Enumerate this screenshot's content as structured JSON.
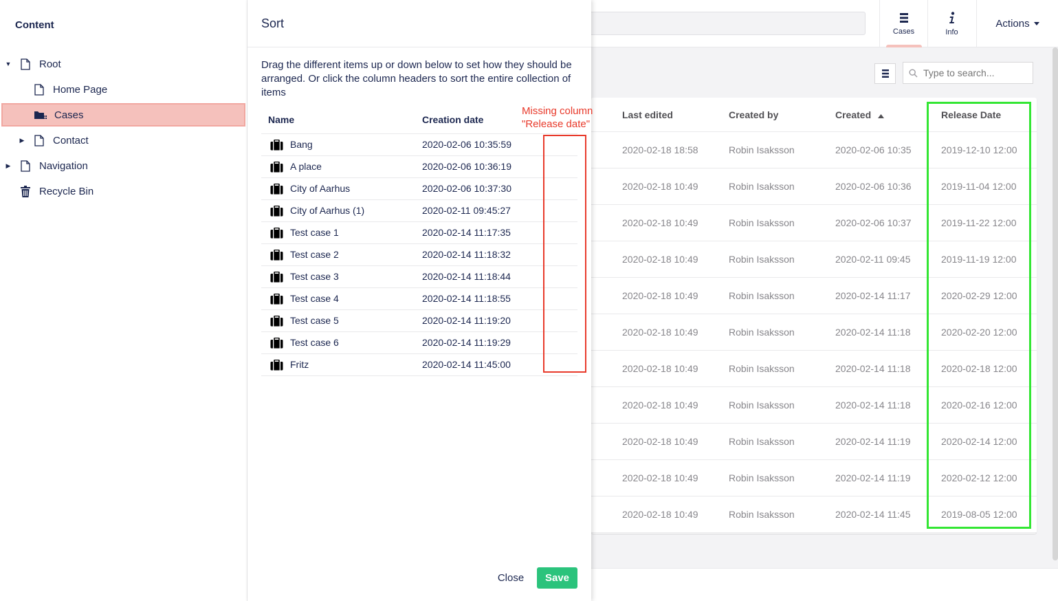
{
  "tree": {
    "heading": "Content",
    "items": [
      {
        "label": "Root",
        "icon": "document-icon",
        "caret": "expanded"
      },
      {
        "label": "Home Page",
        "icon": "document-icon",
        "caret": "none"
      },
      {
        "label": "Cases",
        "icon": "folder-list-icon",
        "caret": "none",
        "selected": true
      },
      {
        "label": "Contact",
        "icon": "document-icon",
        "caret": "collapsed"
      },
      {
        "label": "Navigation",
        "icon": "document-icon",
        "caret": "collapsed"
      },
      {
        "label": "Recycle Bin",
        "icon": "trash-icon",
        "caret": "none"
      }
    ]
  },
  "topbar": {
    "tabs": [
      {
        "label": "Cases",
        "icon": "list-icon",
        "active": true
      },
      {
        "label": "Info",
        "icon": "info-icon",
        "active": false
      }
    ],
    "actions_label": "Actions"
  },
  "list_view": {
    "search_placeholder": "Type to search...",
    "columns": [
      "Last edited",
      "Created by",
      "Created",
      "Release Date"
    ],
    "sorted_column": "Created",
    "rows": [
      {
        "last_edited": "2020-02-18 18:58",
        "created_by": "Robin Isaksson",
        "created": "2020-02-06 10:35",
        "release_date": "2019-12-10 12:00"
      },
      {
        "last_edited": "2020-02-18 10:49",
        "created_by": "Robin Isaksson",
        "created": "2020-02-06 10:36",
        "release_date": "2019-11-04 12:00"
      },
      {
        "last_edited": "2020-02-18 10:49",
        "created_by": "Robin Isaksson",
        "created": "2020-02-06 10:37",
        "release_date": "2019-11-22 12:00"
      },
      {
        "last_edited": "2020-02-18 10:49",
        "created_by": "Robin Isaksson",
        "created": "2020-02-11 09:45",
        "release_date": "2019-11-19 12:00"
      },
      {
        "last_edited": "2020-02-18 10:49",
        "created_by": "Robin Isaksson",
        "created": "2020-02-14 11:17",
        "release_date": "2020-02-29 12:00"
      },
      {
        "last_edited": "2020-02-18 10:49",
        "created_by": "Robin Isaksson",
        "created": "2020-02-14 11:18",
        "release_date": "2020-02-20 12:00"
      },
      {
        "last_edited": "2020-02-18 10:49",
        "created_by": "Robin Isaksson",
        "created": "2020-02-14 11:18",
        "release_date": "2020-02-18 12:00"
      },
      {
        "last_edited": "2020-02-18 10:49",
        "created_by": "Robin Isaksson",
        "created": "2020-02-14 11:18",
        "release_date": "2020-02-16 12:00"
      },
      {
        "last_edited": "2020-02-18 10:49",
        "created_by": "Robin Isaksson",
        "created": "2020-02-14 11:19",
        "release_date": "2020-02-14 12:00"
      },
      {
        "last_edited": "2020-02-18 10:49",
        "created_by": "Robin Isaksson",
        "created": "2020-02-14 11:19",
        "release_date": "2020-02-12 12:00"
      },
      {
        "last_edited": "2020-02-18 10:49",
        "created_by": "Robin Isaksson",
        "created": "2020-02-14 11:45",
        "release_date": "2019-08-05 12:00"
      }
    ]
  },
  "sort_dialog": {
    "title": "Sort",
    "description": "Drag the different items up or down below to set how they should be arranged. Or click the column headers to sort the entire collection of items",
    "columns": {
      "name": "Name",
      "creation_date": "Creation date"
    },
    "rows": [
      {
        "name": "Bang",
        "date": "2020-02-06 10:35:59"
      },
      {
        "name": "A place",
        "date": "2020-02-06 10:36:19"
      },
      {
        "name": "City of Aarhus",
        "date": "2020-02-06 10:37:30"
      },
      {
        "name": "City of Aarhus (1)",
        "date": "2020-02-11 09:45:27"
      },
      {
        "name": "Test case 1",
        "date": "2020-02-14 11:17:35"
      },
      {
        "name": "Test case 2",
        "date": "2020-02-14 11:18:32"
      },
      {
        "name": "Test case 3",
        "date": "2020-02-14 11:18:44"
      },
      {
        "name": "Test case 4",
        "date": "2020-02-14 11:18:55"
      },
      {
        "name": "Test case 5",
        "date": "2020-02-14 11:19:20"
      },
      {
        "name": "Test case 6",
        "date": "2020-02-14 11:19:29"
      },
      {
        "name": "Fritz",
        "date": "2020-02-14 11:45:00"
      }
    ],
    "close_label": "Close",
    "save_label": "Save"
  },
  "annotation": {
    "text": "Missing column\n\"Release date\"",
    "color": "#e8392a",
    "highlight_color": "#33e633"
  }
}
